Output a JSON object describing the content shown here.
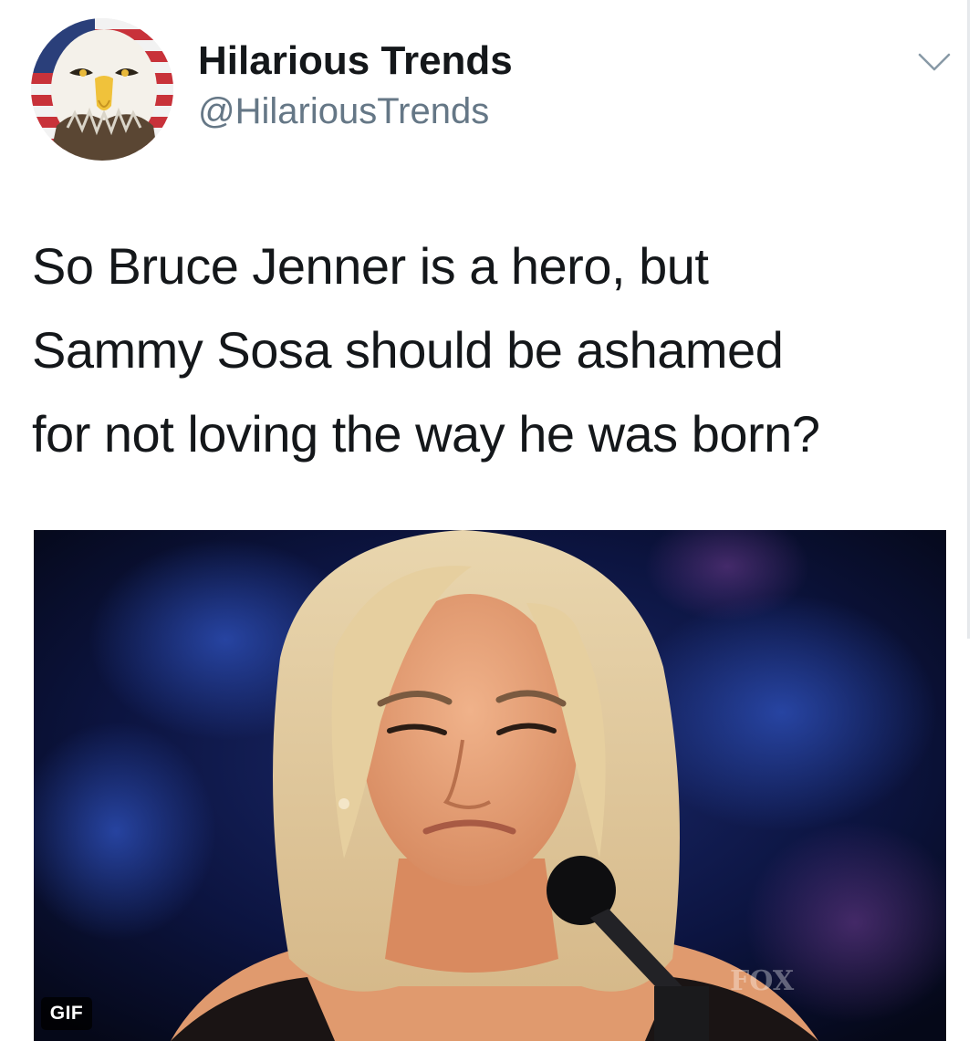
{
  "tweet": {
    "author": {
      "display_name": "Hilarious Trends",
      "handle": "@HilariousTrends",
      "avatar_icon": "bald-eagle-flag-avatar"
    },
    "menu_icon": "chevron-down-icon",
    "text_lines": [
      "So Bruce Jenner is a hero, but",
      "Sammy Sosa should be ashamed",
      "for not loving the way he was born?"
    ],
    "media": {
      "type": "gif",
      "badge_label": "GIF",
      "watermark": "FOX"
    }
  },
  "colors": {
    "text_primary": "#14171a",
    "text_secondary": "#657786",
    "background": "#ffffff"
  }
}
